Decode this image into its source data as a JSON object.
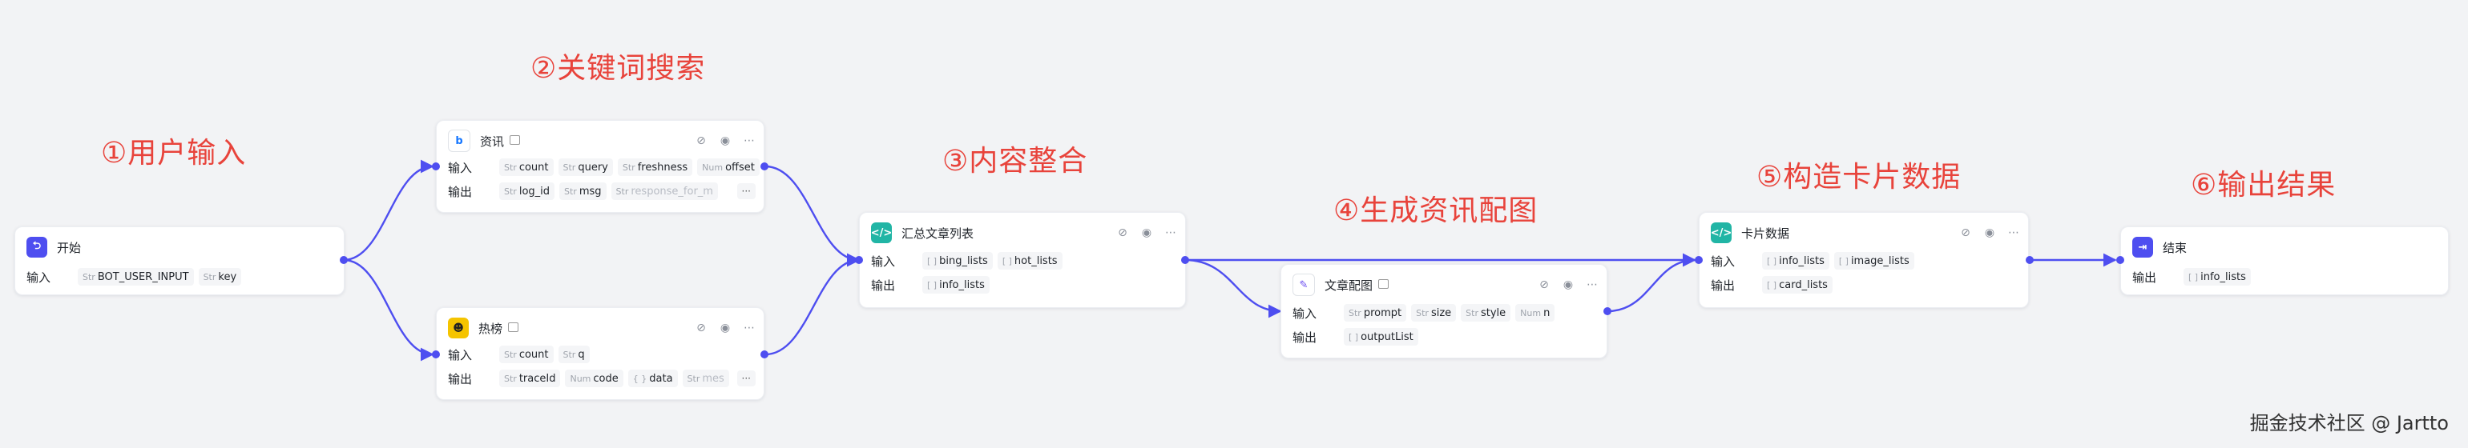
{
  "annotations": {
    "a1": "①用户输入",
    "a2": "②关键词搜索",
    "a3": "③内容整合",
    "a4": "④生成资讯配图",
    "a5": "⑤构造卡片数据",
    "a6": "⑥输出结果"
  },
  "labels": {
    "input": "输入",
    "output": "输出"
  },
  "colors": {
    "edge": "#4e4ef0",
    "annotation": "#e8433b"
  },
  "nodes": {
    "start": {
      "title": "开始",
      "icon": "start-icon",
      "inputs": [
        {
          "type": "Str",
          "name": "BOT_USER_INPUT"
        },
        {
          "type": "Str",
          "name": "key"
        }
      ]
    },
    "news": {
      "title": "资讯",
      "icon": "news-plugin-icon",
      "inputs": [
        {
          "type": "Str",
          "name": "count"
        },
        {
          "type": "Str",
          "name": "query"
        },
        {
          "type": "Str",
          "name": "freshness"
        },
        {
          "type": "Num",
          "name": "offset"
        }
      ],
      "outputs": [
        {
          "type": "Str",
          "name": "log_id"
        },
        {
          "type": "Str",
          "name": "msg"
        },
        {
          "type": "Str",
          "name": "response_for_m"
        }
      ],
      "more": "···"
    },
    "hot": {
      "title": "热榜",
      "icon": "hotlist-plugin-icon",
      "inputs": [
        {
          "type": "Str",
          "name": "count"
        },
        {
          "type": "Str",
          "name": "q"
        }
      ],
      "outputs": [
        {
          "type": "Str",
          "name": "traceId"
        },
        {
          "type": "Num",
          "name": "code"
        },
        {
          "type": "{ }",
          "name": "data"
        },
        {
          "type": "Str",
          "name": "mes"
        }
      ],
      "more": "···"
    },
    "summary": {
      "title": "汇总文章列表",
      "icon": "code-icon",
      "inputs": [
        {
          "type": "[ ]",
          "name": "bing_lists"
        },
        {
          "type": "[ ]",
          "name": "hot_lists"
        }
      ],
      "outputs": [
        {
          "type": "[ ]",
          "name": "info_lists"
        }
      ]
    },
    "image": {
      "title": "文章配图",
      "icon": "image-gen-icon",
      "inputs": [
        {
          "type": "Str",
          "name": "prompt"
        },
        {
          "type": "Str",
          "name": "size"
        },
        {
          "type": "Str",
          "name": "style"
        },
        {
          "type": "Num",
          "name": "n"
        }
      ],
      "outputs": [
        {
          "type": "[ ]",
          "name": "outputList"
        }
      ]
    },
    "card": {
      "title": "卡片数据",
      "icon": "code-icon",
      "inputs": [
        {
          "type": "[ ]",
          "name": "info_lists"
        },
        {
          "type": "[ ]",
          "name": "image_lists"
        }
      ],
      "outputs": [
        {
          "type": "[ ]",
          "name": "card_lists"
        }
      ]
    },
    "end": {
      "title": "结束",
      "icon": "end-icon",
      "outputs": [
        {
          "type": "[ ]",
          "name": "info_lists"
        }
      ]
    }
  },
  "header_actions": [
    "debug-icon",
    "run-icon",
    "more-icon"
  ],
  "watermark": "掘金技术社区 @ Jartto"
}
